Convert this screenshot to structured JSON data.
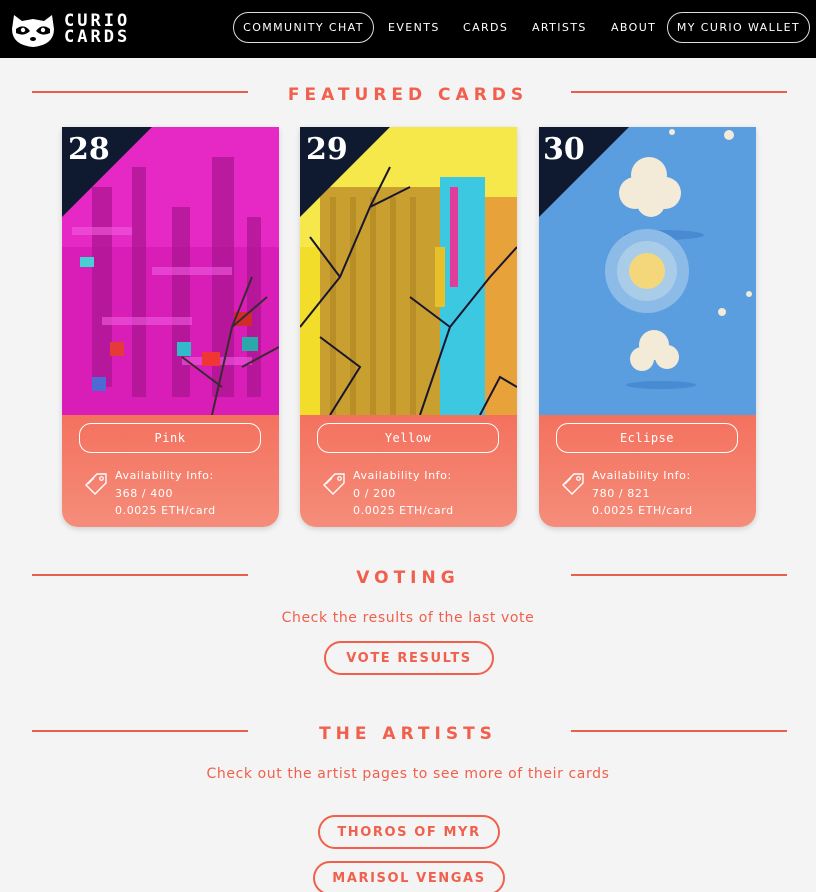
{
  "nav": {
    "logo_line1": "CURIO",
    "logo_line2": "CARDS",
    "community_chat": "COMMUNITY CHAT",
    "events": "EVENTS",
    "cards": "CARDS",
    "artists": "ARTISTS",
    "about": "ABOUT",
    "wallet": "MY CURIO WALLET"
  },
  "featured": {
    "title": "FEATURED CARDS",
    "info_label": "Availability Info:",
    "cards": [
      {
        "number": "28",
        "name": "Pink",
        "availability": "368 / 400",
        "price": "0.0025 ETH/card"
      },
      {
        "number": "29",
        "name": "Yellow",
        "availability": "0 / 200",
        "price": "0.0025 ETH/card"
      },
      {
        "number": "30",
        "name": "Eclipse",
        "availability": "780 / 821",
        "price": "0.0025 ETH/card"
      }
    ]
  },
  "voting": {
    "title": "VOTING",
    "subtitle": "Check the results of the last vote",
    "button": "VOTE RESULTS"
  },
  "artists": {
    "title": "THE ARTISTS",
    "subtitle": "Check out the artist pages to see more of their cards",
    "buttons": [
      "THOROS OF MYR",
      "MARISOL VENGAS"
    ]
  },
  "colors": {
    "accent": "#f0604c",
    "nav_bg": "#000000",
    "page_bg": "#f4f4f4"
  }
}
